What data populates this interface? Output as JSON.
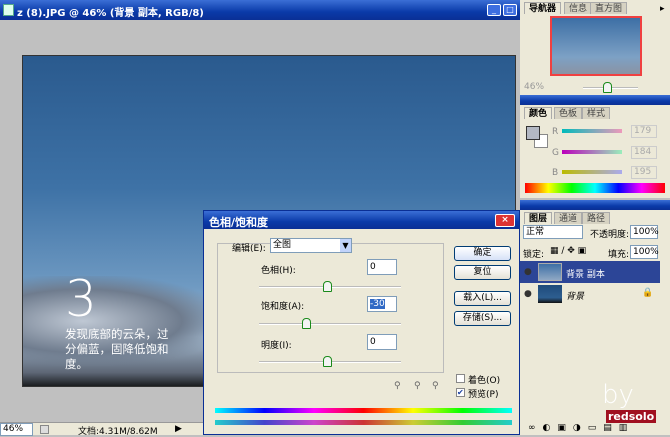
{
  "document": {
    "title": "z (8).JPG @ 46% (背景 副本, RGB/8)",
    "zoom": "46%",
    "doc_size": "文档:4.31M/8.62M",
    "overlay_number": "3",
    "overlay_text_1": "发现底部的云朵，过",
    "overlay_text_2": "分偏蓝，固降低饱和",
    "overlay_text_3": "度。"
  },
  "navigator": {
    "tabs": [
      "导航器",
      "信息",
      "直方图"
    ],
    "zoom": "46%",
    "slider_fraction": 0.45
  },
  "color": {
    "tabs": [
      "颜色",
      "色板",
      "样式"
    ],
    "channels": [
      {
        "label": "R",
        "value": "179"
      },
      {
        "label": "G",
        "value": "184"
      },
      {
        "label": "B",
        "value": "195"
      }
    ],
    "foreground": "#b3b8c3"
  },
  "layers": {
    "tabs": [
      "图层",
      "通道",
      "路径"
    ],
    "blend_mode": "正常",
    "opacity_label": "不透明度:",
    "opacity": "100%",
    "lock_label": "锁定:",
    "fill_label": "填充:",
    "fill": "100%",
    "items": [
      {
        "name": "背景 副本",
        "selected": true
      },
      {
        "name": "背景",
        "locked": true
      }
    ]
  },
  "dialog": {
    "title": "色相/饱和度",
    "edit_label": "编辑(E):",
    "edit_value": "全图",
    "hue_label": "色相(H):",
    "hue": "0",
    "saturation_label": "饱和度(A):",
    "saturation": "-30",
    "lightness_label": "明度(I):",
    "lightness": "0",
    "ok": "确定",
    "reset": "复位",
    "load": "载入(L)...",
    "save": "存储(S)...",
    "colorize": "着色(O)",
    "preview": "预览(P)",
    "colorize_checked": false,
    "preview_checked": true
  },
  "watermark": "by redsolo"
}
